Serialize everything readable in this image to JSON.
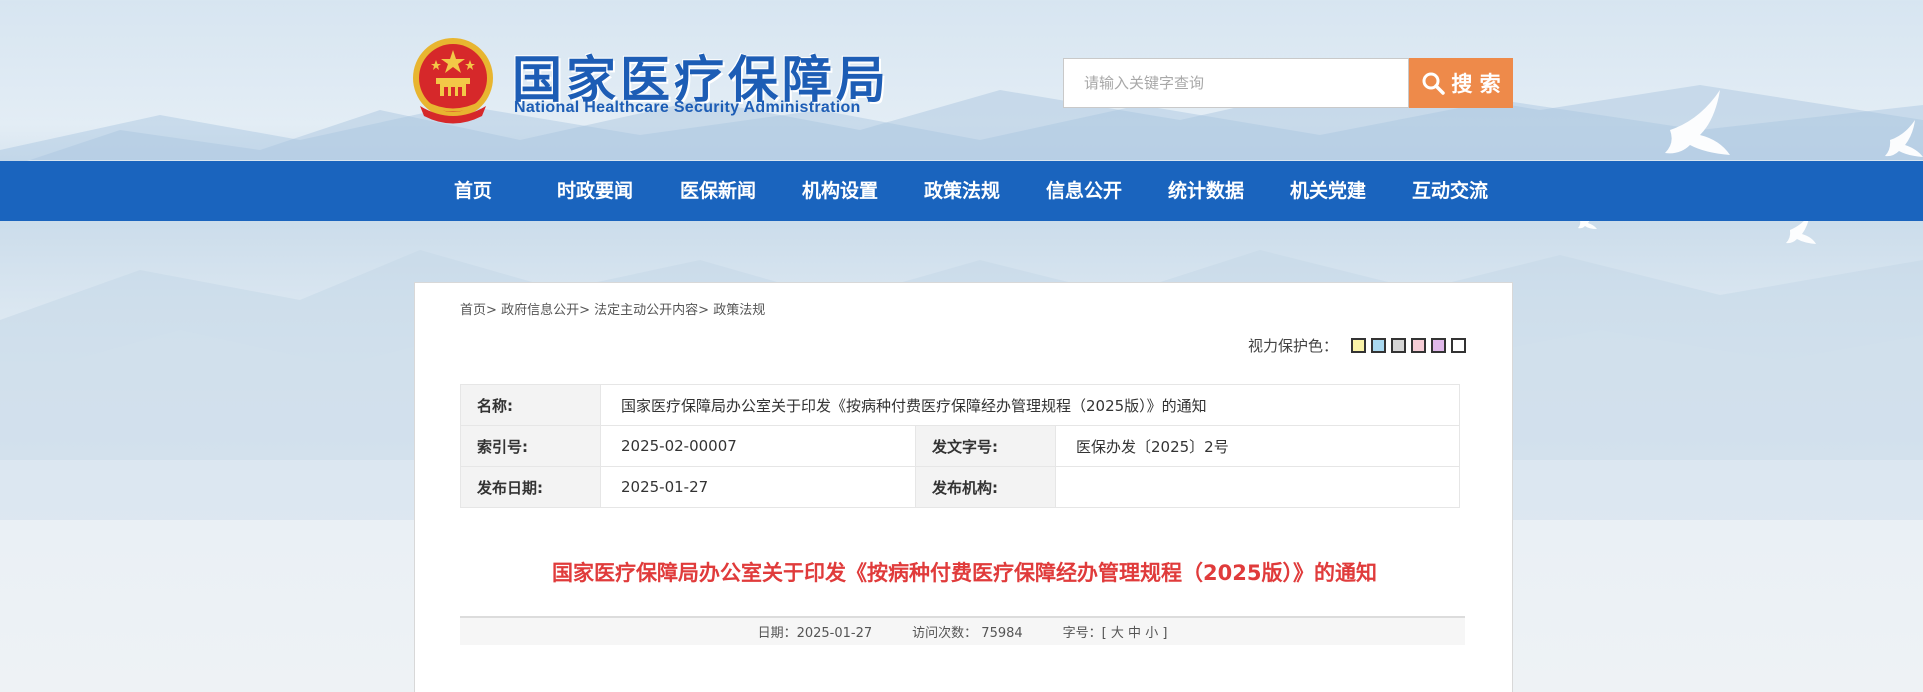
{
  "site": {
    "name_cn": "国家医疗保障局",
    "name_en": "National Healthcare Security Administration"
  },
  "search": {
    "placeholder": "请输入关键字查询",
    "button_label": "搜 索"
  },
  "nav": {
    "items": [
      "首页",
      "时政要闻",
      "医保新闻",
      "机构设置",
      "政策法规",
      "信息公开",
      "统计数据",
      "机关党建",
      "互动交流"
    ]
  },
  "breadcrumb": {
    "items": [
      "首页",
      "政府信息公开",
      "法定主动公开内容",
      "政策法规"
    ],
    "separator": ">"
  },
  "vision": {
    "label": "视力保护色：",
    "colors": [
      "#faf3a8",
      "#a9d9f0",
      "#d7d7d7",
      "#f6cdd6",
      "#e0b8ea",
      "#ffffff"
    ]
  },
  "info": {
    "name_label": "名称:",
    "name_value": "国家医疗保障局办公室关于印发《按病种付费医疗保障经办管理规程（2025版）》的通知",
    "index_label": "索引号:",
    "index_value": "2025-02-00007",
    "docno_label": "发文字号:",
    "docno_value": "医保办发〔2025〕2号",
    "date_label": "发布日期:",
    "date_value": "2025-01-27",
    "org_label": "发布机构:",
    "org_value": ""
  },
  "article": {
    "title": "国家医疗保障局办公室关于印发《按病种付费医疗保障经办管理规程（2025版）》的通知",
    "date_text": "日期：2025-01-27",
    "visits_label": "访问次数：",
    "visits_value": "75984",
    "font_label": "字号：[",
    "font_big": "大",
    "font_mid": "中",
    "font_small": "小",
    "font_end": "]"
  },
  "colors": {
    "nav_bg": "#1a64be",
    "brand_blue": "#1d5db5",
    "search_btn": "#ee8a4a",
    "title_red": "#e03b3b"
  },
  "icons": [
    "national-emblem-icon",
    "search-icon",
    "dove-icon"
  ]
}
